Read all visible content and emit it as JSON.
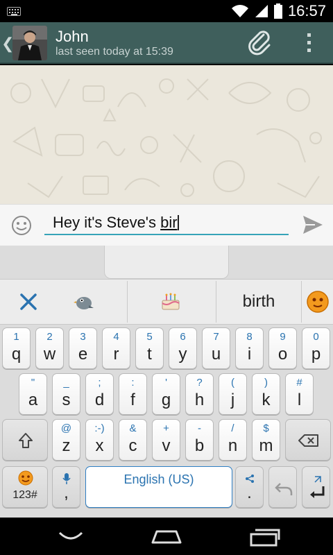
{
  "status_bar": {
    "time": "16:57",
    "icons": [
      "keyboard-notification-icon",
      "wifi-icon",
      "signal-icon",
      "battery-icon"
    ]
  },
  "action_bar": {
    "contact_name": "John",
    "last_seen": "last seen today at 15:39",
    "icons": [
      "back-chevron-icon",
      "avatar",
      "paperclip-icon",
      "overflow-menu-icon"
    ],
    "color": "#3f5f5c"
  },
  "compose": {
    "text_committed": "Hey it's Steve's ",
    "text_composing": "bir",
    "accent_color": "#36a3b8",
    "icons": [
      "emoji-icon",
      "send-icon"
    ]
  },
  "suggestions": {
    "word": "birth",
    "icons": [
      "close-suggestions-icon",
      "bird-emoji-icon",
      "birthday-cake-emoji-icon",
      "orange-emoji-face-icon"
    ]
  },
  "keyboard": {
    "row1": [
      {
        "hint": "1",
        "main": "q"
      },
      {
        "hint": "2",
        "main": "w"
      },
      {
        "hint": "3",
        "main": "e"
      },
      {
        "hint": "4",
        "main": "r"
      },
      {
        "hint": "5",
        "main": "t"
      },
      {
        "hint": "6",
        "main": "y"
      },
      {
        "hint": "7",
        "main": "u"
      },
      {
        "hint": "8",
        "main": "i"
      },
      {
        "hint": "9",
        "main": "o"
      },
      {
        "hint": "0",
        "main": "p"
      }
    ],
    "row2": [
      {
        "hint": "\"",
        "main": "a"
      },
      {
        "hint": "_",
        "main": "s"
      },
      {
        "hint": ";",
        "main": "d"
      },
      {
        "hint": ":",
        "main": "f"
      },
      {
        "hint": "'",
        "main": "g"
      },
      {
        "hint": "?",
        "main": "h"
      },
      {
        "hint": "(",
        "main": "j"
      },
      {
        "hint": ")",
        "main": "k"
      },
      {
        "hint": "#",
        "main": "l"
      }
    ],
    "row3": [
      {
        "hint": "@",
        "main": "z"
      },
      {
        "hint": ":-)",
        "main": "x"
      },
      {
        "hint": "&",
        "main": "c"
      },
      {
        "hint": "+",
        "main": "v"
      },
      {
        "hint": "-",
        "main": "b"
      },
      {
        "hint": "/",
        "main": "n"
      },
      {
        "hint": "$",
        "main": "m"
      }
    ],
    "symbols_label": "123#",
    "comma_label": ",",
    "period_label": ".",
    "space_label": "English (US)",
    "key_icons": [
      "shift-icon",
      "backspace-icon",
      "emoji-smiley-icon",
      "microphone-icon",
      "share-icon",
      "undo-icon",
      "enter-icon"
    ]
  },
  "nav_bar": {
    "icons": [
      "back-icon",
      "home-icon",
      "recent-apps-icon"
    ]
  }
}
